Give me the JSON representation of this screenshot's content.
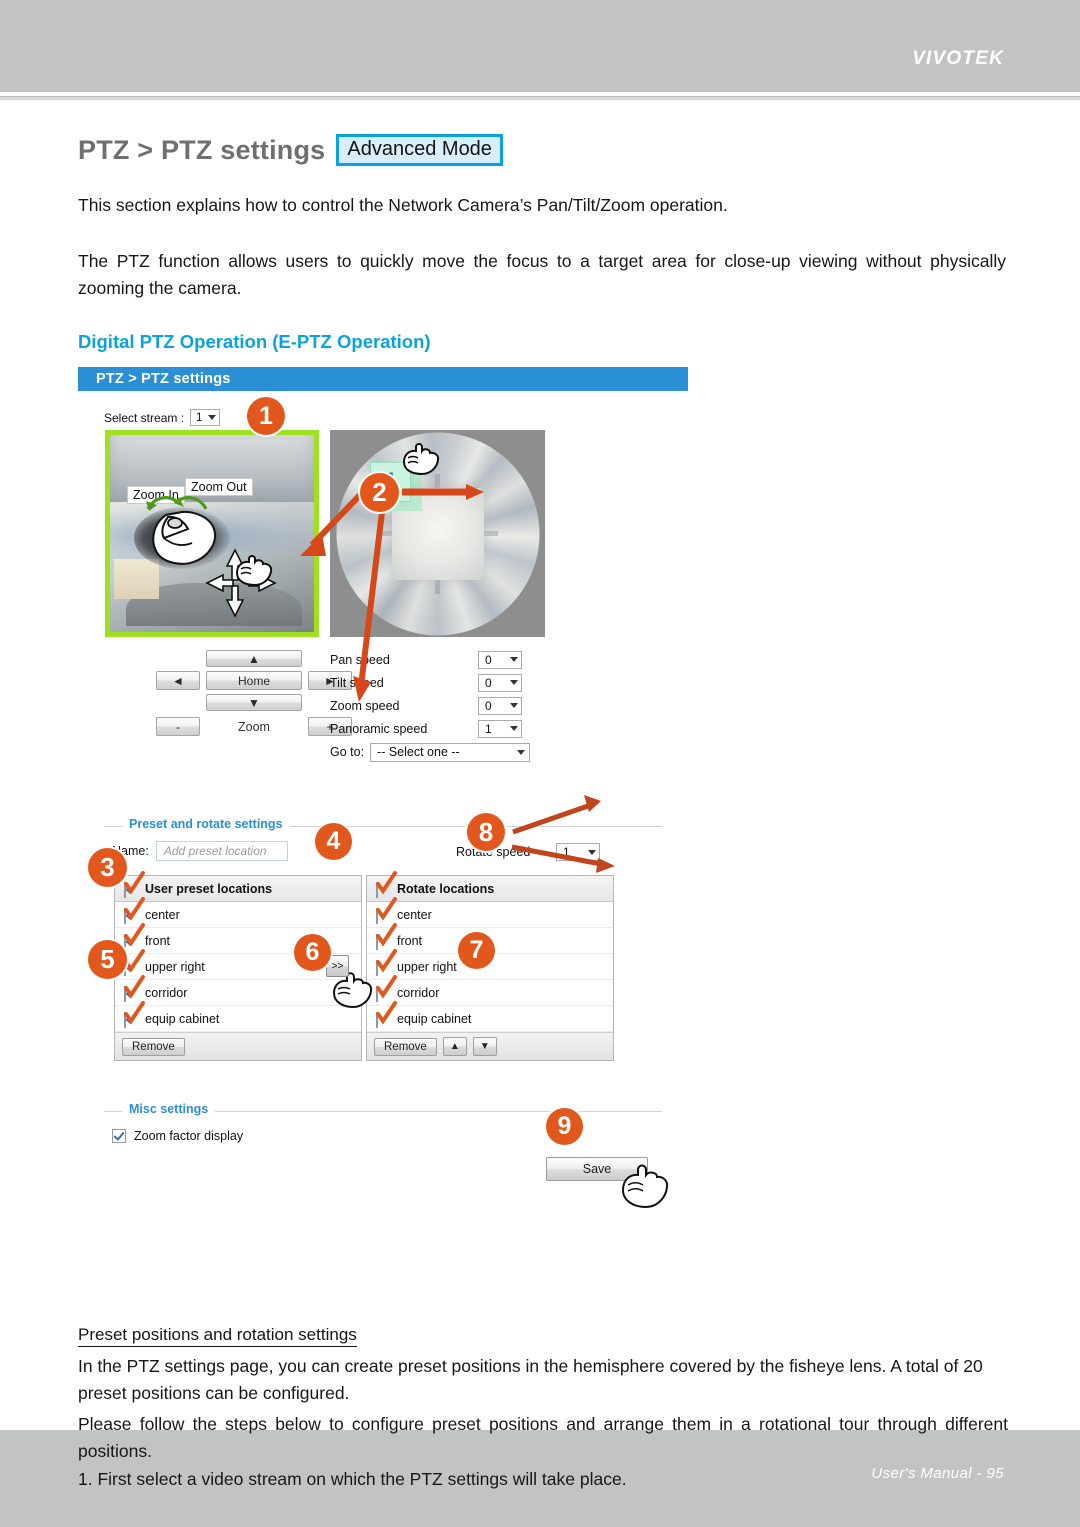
{
  "header": {
    "brand": "VIVOTEK"
  },
  "footer": {
    "text": "User's Manual - 95"
  },
  "page": {
    "title_main": "PTZ > PTZ settings",
    "mode_chip": "Advanced Mode",
    "paragraph_1": "This section explains how to control the Network Camera’s Pan/Tilt/Zoom operation.",
    "paragraph_2": "The PTZ function allows users to quickly move the focus to a target area for close-up viewing without physically zooming the camera.",
    "section_heading": "Digital PTZ Operation (E-PTZ Operation)",
    "sub_heading": "Preset positions and rotation settings",
    "paragraph_3": "In the PTZ settings page, you can create preset positions in the hemisphere covered by the fisheye lens. A total of 20 preset positions can be configured.",
    "paragraph_4": "Please follow the steps below to configure preset positions and arrange them in a rotational tour through different positions.",
    "paragraph_5": "1. First select a video stream on which the PTZ settings will take place."
  },
  "app": {
    "titlebar": "PTZ  > PTZ settings",
    "select_stream_label": "Select stream :",
    "select_stream_value": "1",
    "liveview": {
      "zoom_in_label": "Zoom In",
      "zoom_out_label": "Zoom Out"
    },
    "fisheye": {
      "region_badge": "1"
    },
    "dpad": {
      "up": "▲",
      "down": "▼",
      "left": "◄",
      "right": "►",
      "home": "Home",
      "zoom_label": "Zoom",
      "zoom_minus": "-",
      "zoom_plus": "+"
    },
    "speeds": [
      {
        "label": "Pan speed",
        "value": "0"
      },
      {
        "label": "Tilt speed",
        "value": "0"
      },
      {
        "label": "Zoom speed",
        "value": "0"
      },
      {
        "label": "Panoramic speed",
        "value": "1"
      }
    ],
    "goto": {
      "label": "Go to:",
      "value": "-- Select one --"
    },
    "preset_section": {
      "legend": "Preset and rotate settings",
      "name_label": "Name:",
      "name_placeholder": "Add preset location",
      "rotate_speed_label": "Rotate speed",
      "rotate_speed_value": "1",
      "transfer_button": ">>",
      "user_preset": {
        "header": "User preset locations",
        "items": [
          "center",
          "front",
          "upper right",
          "corridor",
          "equip cabinet"
        ],
        "remove_label": "Remove"
      },
      "rotate_locations": {
        "header": "Rotate locations",
        "items": [
          "center",
          "front",
          "upper right",
          "corridor",
          "equip cabinet"
        ],
        "remove_label": "Remove",
        "move_up": "▲",
        "move_down": "▼"
      }
    },
    "misc_section": {
      "legend": "Misc settings",
      "zoom_factor_label": "Zoom factor display",
      "save_label": "Save"
    }
  },
  "callouts": {
    "n1": "1",
    "n2": "2",
    "n3": "3",
    "n4": "4",
    "n5": "5",
    "n6": "6",
    "n7": "7",
    "n8": "8",
    "n9": "9"
  },
  "colors": {
    "brand_gray": "#c2c4c3",
    "accent_blue": "#0aa3e0",
    "titlebar_blue": "#2a8fd4",
    "callout_orange": "#e2581c",
    "highlight_green": "#9de21c"
  }
}
